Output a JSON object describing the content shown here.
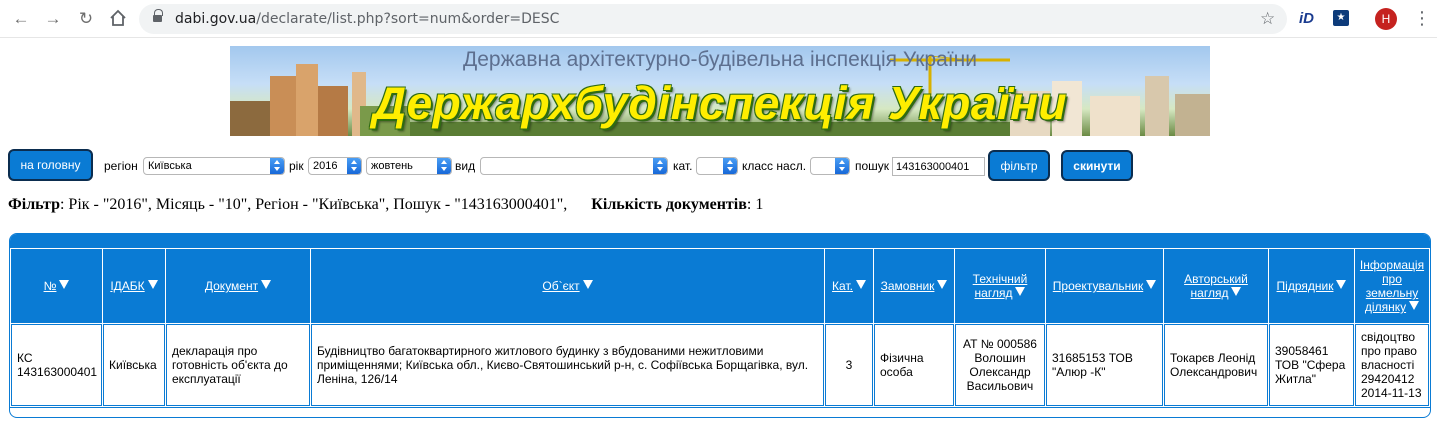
{
  "browser": {
    "url_host": "dabi.gov.ua",
    "url_path": "/declarate/list.php?sort=num&order=DESC",
    "extension1_label": "iD",
    "profile_initial": "H",
    "icons": [
      "back-arrow-icon",
      "forward-arrow-icon",
      "reload-icon",
      "home-icon",
      "lock-icon",
      "star-icon",
      "menu-dots-icon"
    ]
  },
  "banner": {
    "subtitle": "Державна архітектурно-будівельна інспекція України",
    "title": "Держархбудінспекція України"
  },
  "filters": {
    "home_button": "на головну",
    "region_label": "регіон",
    "region_value": "Київська",
    "year_label": "рік",
    "year_value": "2016",
    "month_value": "жовтень",
    "type_label": "вид",
    "type_value": "",
    "cat_label": "кат.",
    "cat_value": "",
    "class_label": "класс насл.",
    "class_value": "",
    "search_label": "пошук",
    "search_value": "143163000401",
    "filter_button": "фільтр",
    "reset_button": "скинути"
  },
  "summary": {
    "filter_label": "Фільтр",
    "filter_text": ": Рік - \"2016\", Місяць - \"10\", Регіон - \"Київська\", Пошук - \"143163000401\",",
    "count_label": "Кількість документів",
    "count_text": ": 1"
  },
  "table": {
    "headers": [
      "№",
      "ІДАБК",
      "Документ",
      "Об`єкт",
      "Кат.",
      "Замовник",
      "Технічний нагляд",
      "Проектувальник",
      "Авторський нагляд",
      "Підрядник",
      "Інформація про земельну ділянку"
    ],
    "rows": [
      {
        "num": "КС 143163000401",
        "idabk": "Київська",
        "document": "декларація про готовність об'єкта до експлуатації",
        "object": "Будівництво багатоквартирного житлового будинку з вбудованими нежитловими приміщеннями; Київська обл., Києво-Святошинський р-н, с. Софіївська Борщагівка, вул. Леніна, 126/14",
        "category": "3",
        "customer": "Фізична особа",
        "tech_supervision": "АТ № 000586 Волошин Олександр Васильович",
        "designer": "31685153 ТОВ \"Алюр -К\"",
        "author_supervision": "Токарєв Леонід Олександрович",
        "contractor": "39058461 ТОВ \"Сфера Житла\"",
        "land_info": "свідоцтво про право власності 29420412 2014-11-13"
      }
    ]
  },
  "colors": {
    "accent": "#0a7bd4",
    "banner_title": "#ffee00",
    "profile": "#c5221f"
  }
}
